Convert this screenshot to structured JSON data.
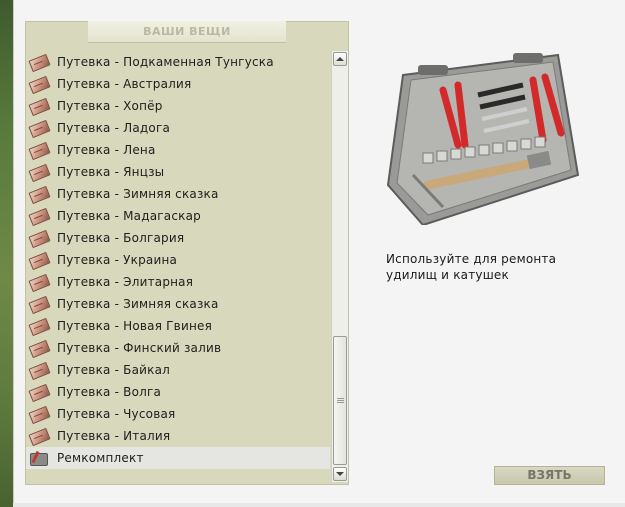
{
  "panel": {
    "title": "ВАШИ ВЕЩИ"
  },
  "items": [
    {
      "label": "Путевка - Подкаменная Тунгуска",
      "icon": "ticket-icon"
    },
    {
      "label": "Путевка - Австралия",
      "icon": "ticket-icon"
    },
    {
      "label": "Путевка - Хопёр",
      "icon": "ticket-icon"
    },
    {
      "label": "Путевка - Ладога",
      "icon": "ticket-icon"
    },
    {
      "label": "Путевка - Лена",
      "icon": "ticket-icon"
    },
    {
      "label": "Путевка - Янцзы",
      "icon": "ticket-icon"
    },
    {
      "label": "Путевка - Зимняя сказка",
      "icon": "ticket-icon"
    },
    {
      "label": "Путевка - Мадагаскар",
      "icon": "ticket-icon"
    },
    {
      "label": "Путевка - Болгария",
      "icon": "ticket-icon"
    },
    {
      "label": "Путевка - Украина",
      "icon": "ticket-icon"
    },
    {
      "label": "Путевка - Элитарная",
      "icon": "ticket-icon"
    },
    {
      "label": "Путевка - Зимняя сказка",
      "icon": "ticket-icon"
    },
    {
      "label": "Путевка - Новая Гвинея",
      "icon": "ticket-icon"
    },
    {
      "label": "Путевка - Финский залив",
      "icon": "ticket-icon"
    },
    {
      "label": "Путевка - Байкал",
      "icon": "ticket-icon"
    },
    {
      "label": "Путевка - Волга",
      "icon": "ticket-icon"
    },
    {
      "label": "Путевка - Чусовая",
      "icon": "ticket-icon"
    },
    {
      "label": "Путевка - Италия",
      "icon": "ticket-icon"
    },
    {
      "label": "Ремкомплект",
      "icon": "repair-kit-icon",
      "selected": true
    }
  ],
  "detail": {
    "image": "toolbox-image",
    "description": "Используйте для ремонта удилищ и катушек"
  },
  "actions": {
    "take_label": "ВЗЯТЬ"
  },
  "colors": {
    "panel_bg": "#d8d8bc",
    "selected_row": "#e5e5e1",
    "button_bg": "#d2d2b8"
  }
}
